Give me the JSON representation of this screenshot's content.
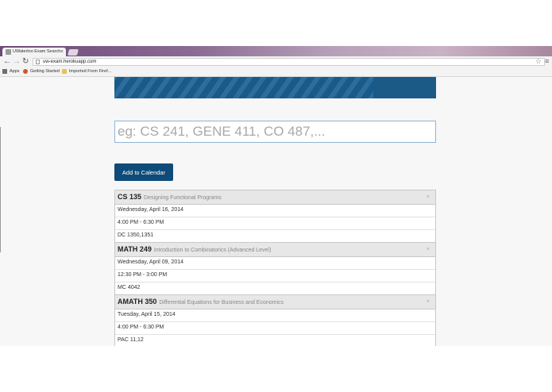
{
  "browser": {
    "tab_title": "UWaterloo Exam Search",
    "tab_close": "×",
    "url": "uw-exam.herokuapp.com",
    "bookmarks": [
      "Apps",
      "Getting Started",
      "Imported From Firef..."
    ]
  },
  "page": {
    "search_placeholder": "eg: CS 241, GENE 411, CO 487,...",
    "add_button_label": "Add to Calendar",
    "exams": [
      {
        "code": "CS 135",
        "title": "Designing Functional Programs",
        "date": "Wednesday, April 16, 2014",
        "time": "4:00 PM - 6:30 PM",
        "location": "DC 1350,1351",
        "close": "×"
      },
      {
        "code": "MATH 249",
        "title": "Introduction to Combinatorics (Advanced Level)",
        "date": "Wednesday, April 09, 2014",
        "time": "12:30 PM - 3:00 PM",
        "location": "MC 4042",
        "close": "×"
      },
      {
        "code": "AMATH 350",
        "title": "Differential Equations for Business and Economics",
        "date": "Tuesday, April 15, 2014",
        "time": "4:00 PM - 6:30 PM",
        "location": "PAC 11,12",
        "close": "×"
      }
    ]
  },
  "colors": {
    "banner": "#1b5a86",
    "button": "#0e4b79"
  }
}
